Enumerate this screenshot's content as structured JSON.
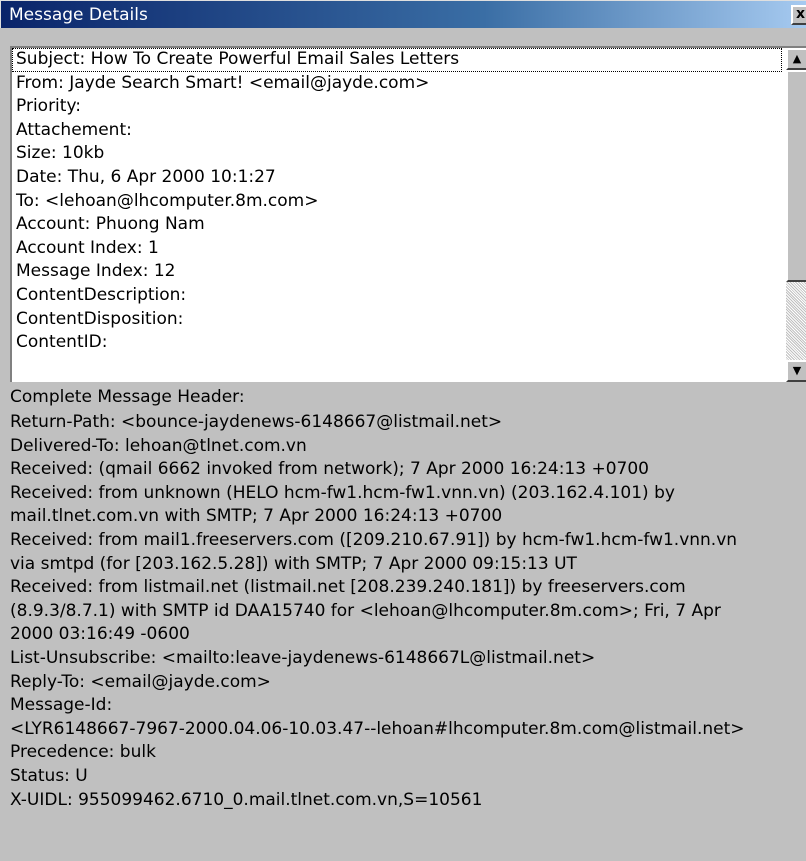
{
  "window": {
    "title": "Message Details",
    "close_glyph": "x"
  },
  "details_list": [
    "Subject: How To Create Powerful Email Sales Letters",
    "From: Jayde Search Smart! <email@jayde.com>",
    "Priority:",
    "Attachement:",
    "Size: 10kb",
    "Date: Thu, 6 Apr 2000 10:1:27",
    "To: <lehoan@lhcomputer.8m.com>",
    "Account: Phuong Nam",
    "Account Index: 1",
    "Message Index: 12",
    "ContentDescription:",
    "ContentDisposition:",
    "ContentID:"
  ],
  "scrollbar": {
    "up_glyph": "▲",
    "down_glyph": "▼"
  },
  "complete_header": {
    "label": "Complete Message Header:",
    "lines": [
      "Return-Path: <bounce-jaydenews-6148667@listmail.net>",
      "Delivered-To: lehoan@tlnet.com.vn",
      "Received: (qmail 6662 invoked from network); 7 Apr 2000 16:24:13 +0700",
      "Received: from unknown (HELO hcm-fw1.hcm-fw1.vnn.vn) (203.162.4.101) by",
      "mail.tlnet.com.vn with SMTP; 7 Apr 2000 16:24:13 +0700",
      "Received: from mail1.freeservers.com ([209.210.67.91]) by hcm-fw1.hcm-fw1.vnn.vn",
      "via smtpd (for [203.162.5.28]) with SMTP; 7 Apr 2000 09:15:13 UT",
      "Received: from listmail.net (listmail.net [208.239.240.181]) by freeservers.com",
      "(8.9.3/8.7.1) with SMTP id DAA15740 for <lehoan@lhcomputer.8m.com>; Fri, 7 Apr",
      "2000 03:16:49 -0600",
      "List-Unsubscribe: <mailto:leave-jaydenews-6148667L@listmail.net>",
      "Reply-To: <email@jayde.com>",
      "Message-Id:",
      "<LYR6148667-7967-2000.04.06-10.03.47--lehoan#lhcomputer.8m.com@listmail.net>",
      "Precedence: bulk",
      "Status:  U",
      "X-UIDL: 955099462.6710_0.mail.tlnet.com.vn,S=10561"
    ]
  }
}
